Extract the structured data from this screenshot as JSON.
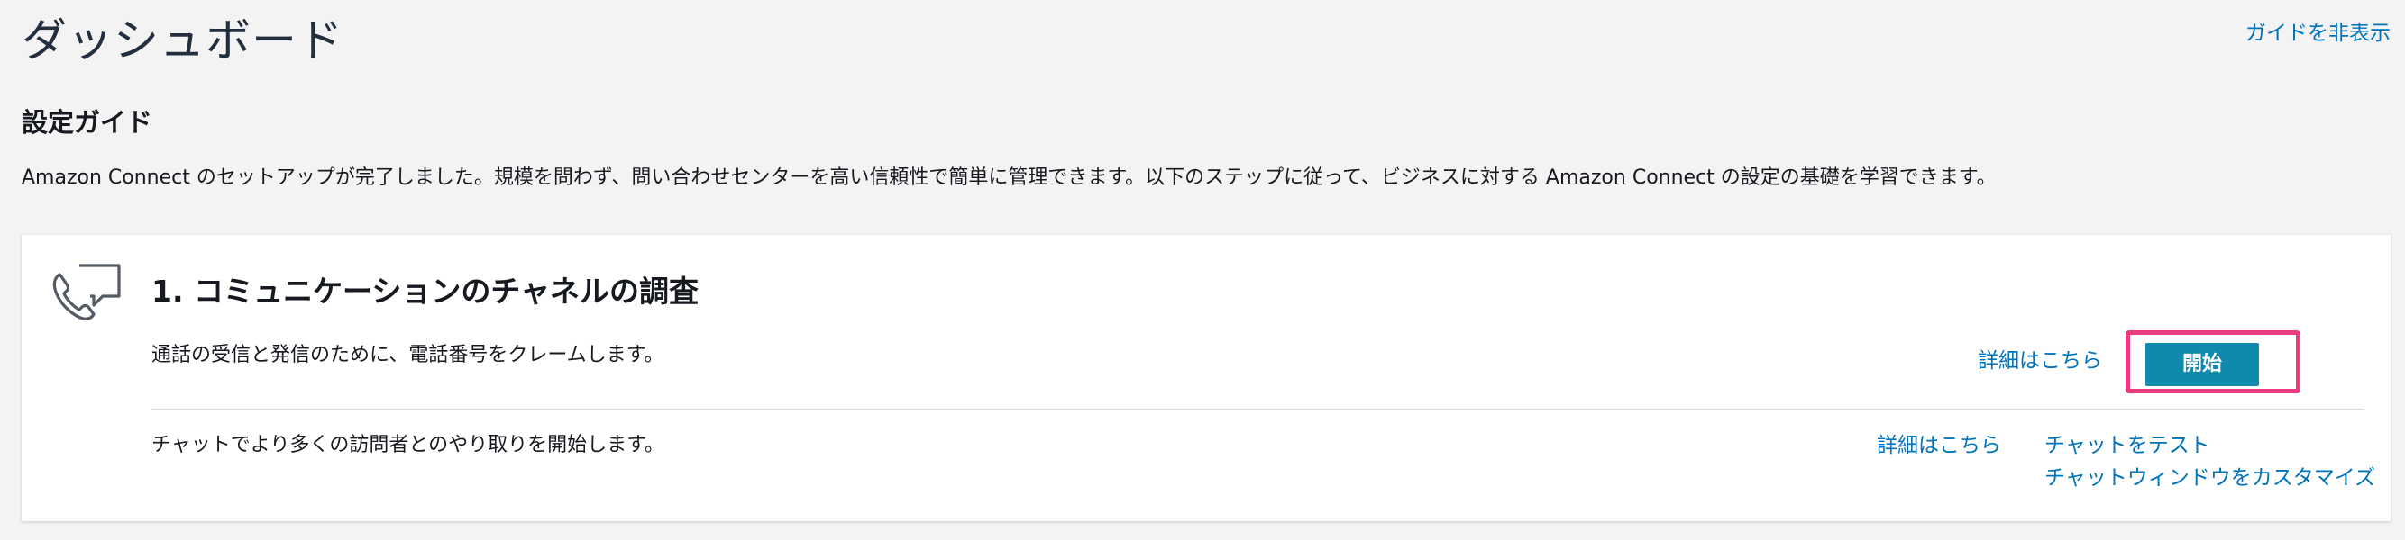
{
  "page": {
    "title": "ダッシュボード",
    "hide_guide_link": "ガイドを非表示"
  },
  "setup_guide": {
    "title": "設定ガイド",
    "intro": "Amazon Connect のセットアップが完了しました。規模を問わず、問い合わせセンターを高い信頼性で簡単に管理できます。以下のステップに従って、ビジネスに対する Amazon Connect の設定の基礎を学習できます。"
  },
  "step1": {
    "icon": "phone-chat-icon",
    "title": "1. コミュニケーションのチャネルの調査",
    "rows": [
      {
        "description": "通話の受信と発信のために、電話番号をクレームします。",
        "details_link": "詳細はこちら",
        "start_button": "開始"
      },
      {
        "description": "チャットでより多くの訪問者とのやり取りを開始します。",
        "details_link": "詳細はこちら",
        "test_chat_link": "チャットをテスト",
        "customize_link": "チャットウィンドウをカスタマイズ"
      }
    ]
  },
  "colors": {
    "background": "#f3f3f3",
    "link": "#0073bb",
    "button": "#0f89ad",
    "highlight": "#e83c7e"
  }
}
